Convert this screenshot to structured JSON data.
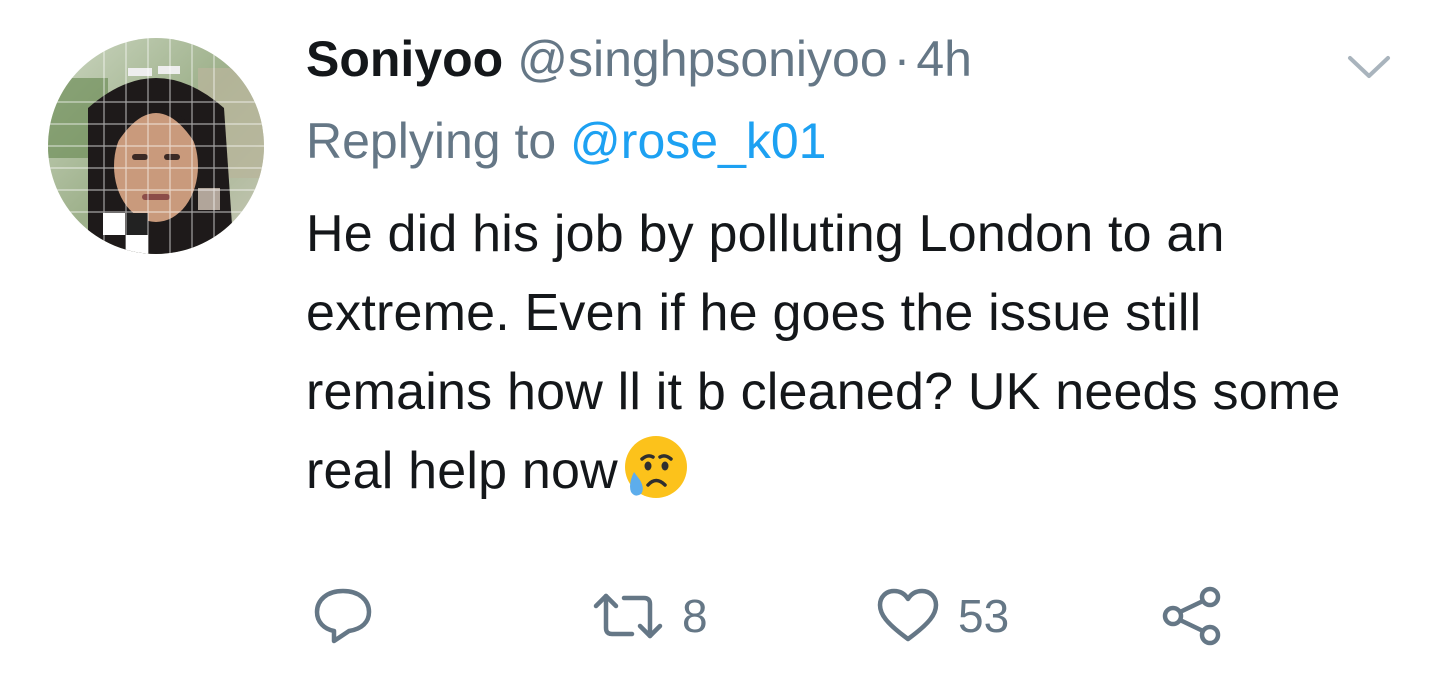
{
  "tweet": {
    "author": {
      "name": "Soniyoo",
      "handle": "@singhpsoniyoo",
      "separator": "·",
      "time": "4h",
      "avatar_icon": "profile-photo"
    },
    "replying": {
      "prefix": "Replying to ",
      "mention": "@rose_k01"
    },
    "text": "He did his job by polluting London to an extreme. Even if he goes the issue still remains how ll it b cleaned? UK needs some real help now",
    "emoji": "sad-but-relieved-face-emoji",
    "menu_icon": "chevron-down-icon",
    "actions": {
      "reply": {
        "icon": "reply-icon",
        "count": ""
      },
      "retweet": {
        "icon": "retweet-icon",
        "count": "8"
      },
      "like": {
        "icon": "heart-icon",
        "count": "53"
      },
      "share": {
        "icon": "share-icon"
      }
    },
    "colors": {
      "text": "#14171a",
      "secondary": "#657786",
      "link": "#1da1f2",
      "icon": "#657786"
    }
  }
}
